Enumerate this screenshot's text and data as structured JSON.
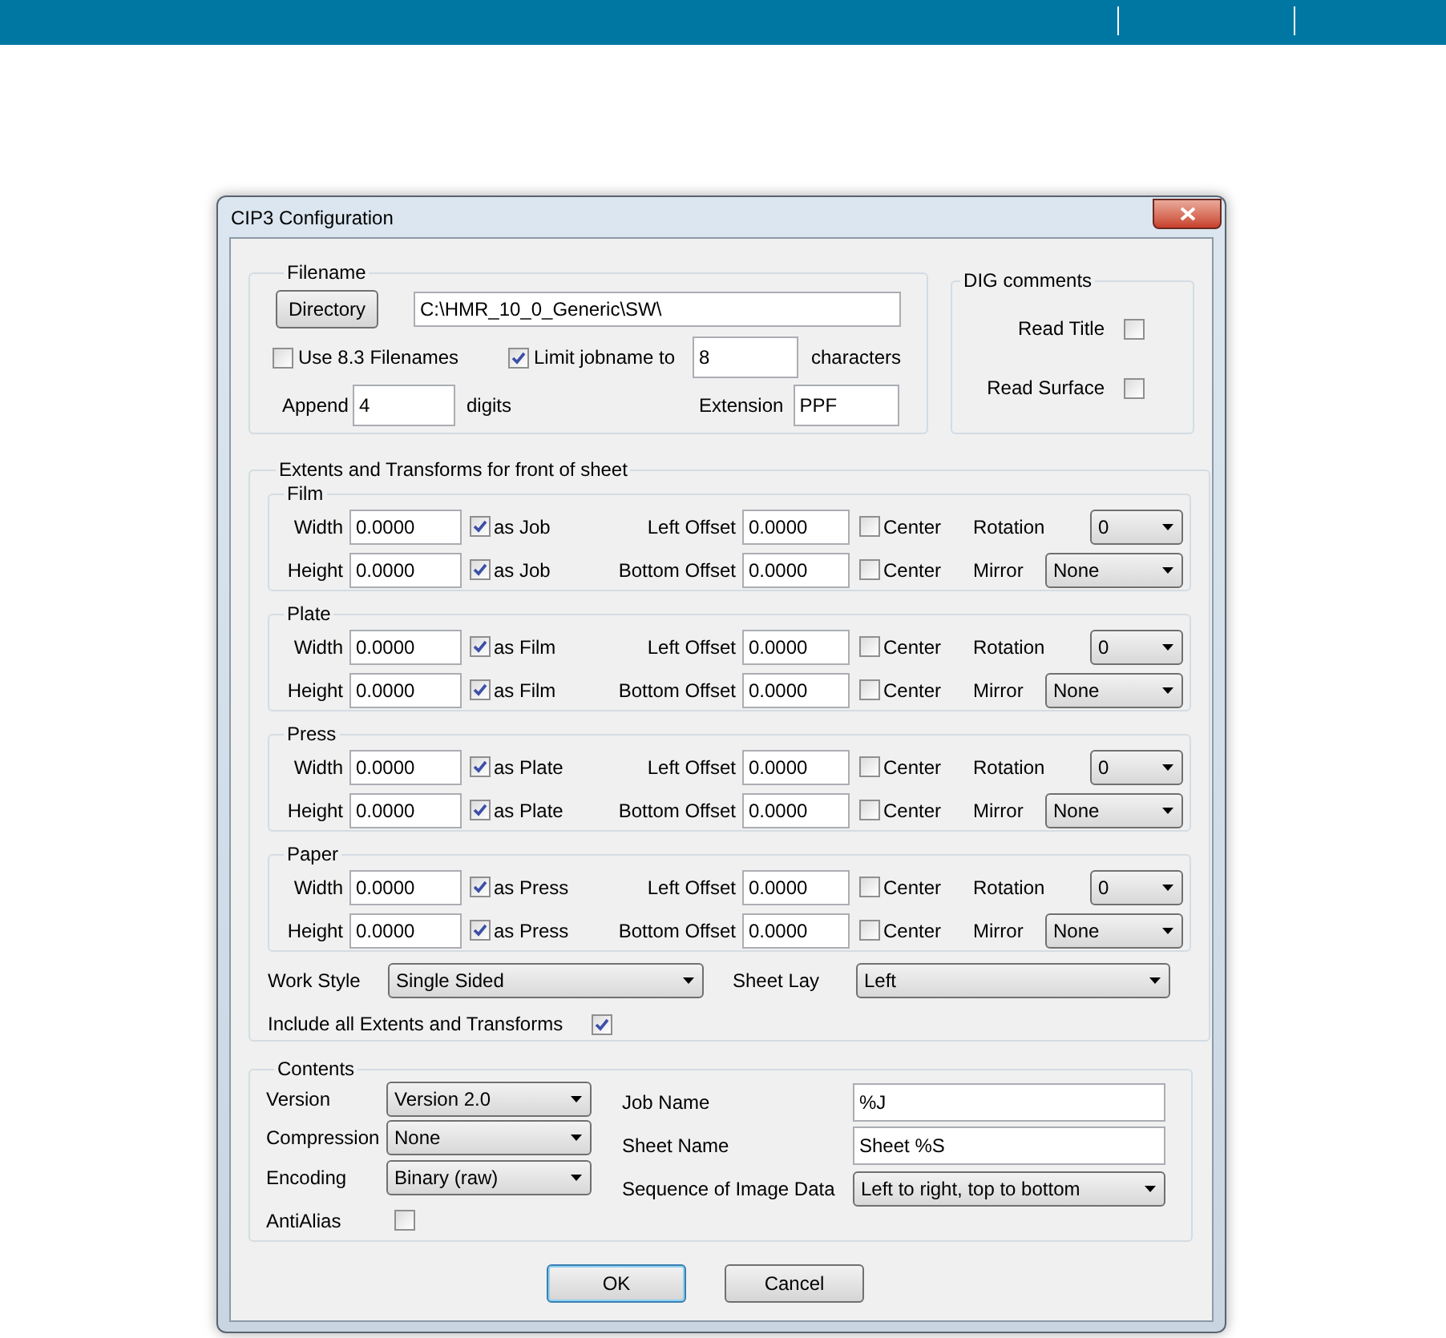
{
  "window": {
    "title": "CIP3 Configuration"
  },
  "filename": {
    "legend": "Filename",
    "directory_button": "Directory",
    "path": "C:\\HMR_10_0_Generic\\SW\\",
    "use_83": {
      "label": "Use 8.3 Filenames",
      "checked": false
    },
    "limit": {
      "label": "Limit jobname to",
      "checked": true,
      "value": "8",
      "suffix": "characters"
    },
    "append": {
      "label": "Append",
      "value": "4",
      "suffix": "digits"
    },
    "extension": {
      "label": "Extension",
      "value": "PPF"
    }
  },
  "dig_comments": {
    "legend": "DIG comments",
    "options": [
      {
        "label": "Read Title",
        "checked": false
      },
      {
        "label": "Read Surface",
        "checked": false
      }
    ]
  },
  "extents": {
    "legend": "Extents and Transforms for front of sheet",
    "groups": [
      {
        "legend": "Film",
        "rows": [
          {
            "label": "Width",
            "value": "0.0000",
            "link": {
              "label": "as Job",
              "checked": true
            },
            "offset": {
              "label": "Left Offset",
              "value": "0.0000"
            },
            "center": {
              "label": "Center",
              "checked": false
            },
            "option": {
              "kind": "rotation",
              "label": "Rotation",
              "value": "0"
            }
          },
          {
            "label": "Height",
            "value": "0.0000",
            "link": {
              "label": "as Job",
              "checked": true
            },
            "offset": {
              "label": "Bottom Offset",
              "value": "0.0000"
            },
            "center": {
              "label": "Center",
              "checked": false
            },
            "option": {
              "kind": "mirror",
              "label": "Mirror",
              "value": "None"
            }
          }
        ]
      },
      {
        "legend": "Plate",
        "rows": [
          {
            "label": "Width",
            "value": "0.0000",
            "link": {
              "label": "as Film",
              "checked": true
            },
            "offset": {
              "label": "Left Offset",
              "value": "0.0000"
            },
            "center": {
              "label": "Center",
              "checked": false
            },
            "option": {
              "kind": "rotation",
              "label": "Rotation",
              "value": "0"
            }
          },
          {
            "label": "Height",
            "value": "0.0000",
            "link": {
              "label": "as Film",
              "checked": true
            },
            "offset": {
              "label": "Bottom Offset",
              "value": "0.0000"
            },
            "center": {
              "label": "Center",
              "checked": false
            },
            "option": {
              "kind": "mirror",
              "label": "Mirror",
              "value": "None"
            }
          }
        ]
      },
      {
        "legend": "Press",
        "rows": [
          {
            "label": "Width",
            "value": "0.0000",
            "link": {
              "label": "as Plate",
              "checked": true
            },
            "offset": {
              "label": "Left Offset",
              "value": "0.0000"
            },
            "center": {
              "label": "Center",
              "checked": false
            },
            "option": {
              "kind": "rotation",
              "label": "Rotation",
              "value": "0"
            }
          },
          {
            "label": "Height",
            "value": "0.0000",
            "link": {
              "label": "as Plate",
              "checked": true
            },
            "offset": {
              "label": "Bottom Offset",
              "value": "0.0000"
            },
            "center": {
              "label": "Center",
              "checked": false
            },
            "option": {
              "kind": "mirror",
              "label": "Mirror",
              "value": "None"
            }
          }
        ]
      },
      {
        "legend": "Paper",
        "rows": [
          {
            "label": "Width",
            "value": "0.0000",
            "link": {
              "label": "as Press",
              "checked": true
            },
            "offset": {
              "label": "Left Offset",
              "value": "0.0000"
            },
            "center": {
              "label": "Center",
              "checked": false
            },
            "option": {
              "kind": "rotation",
              "label": "Rotation",
              "value": "0"
            }
          },
          {
            "label": "Height",
            "value": "0.0000",
            "link": {
              "label": "as Press",
              "checked": true
            },
            "offset": {
              "label": "Bottom Offset",
              "value": "0.0000"
            },
            "center": {
              "label": "Center",
              "checked": false
            },
            "option": {
              "kind": "mirror",
              "label": "Mirror",
              "value": "None"
            }
          }
        ]
      }
    ],
    "work_style": {
      "label": "Work Style",
      "value": "Single Sided"
    },
    "sheet_lay": {
      "label": "Sheet Lay",
      "value": "Left"
    },
    "include_all": {
      "label": "Include all Extents and Transforms",
      "checked": true
    }
  },
  "contents": {
    "legend": "Contents",
    "left": [
      {
        "kind": "dropdown",
        "label": "Version",
        "value": "Version 2.0"
      },
      {
        "kind": "dropdown",
        "label": "Compression",
        "value": "None"
      },
      {
        "kind": "dropdown",
        "label": "Encoding",
        "value": "Binary (raw)"
      },
      {
        "kind": "checkbox",
        "label": "AntiAlias",
        "checked": false
      }
    ],
    "right": [
      {
        "kind": "field",
        "label": "Job Name",
        "value": "%J"
      },
      {
        "kind": "field",
        "label": "Sheet Name",
        "value": "Sheet %S"
      },
      {
        "kind": "dropdown",
        "label": "Sequence of Image Data",
        "value": "Left to right, top to bottom"
      }
    ]
  },
  "buttons": [
    {
      "label": "OK",
      "default": true
    },
    {
      "label": "Cancel",
      "default": false
    }
  ]
}
